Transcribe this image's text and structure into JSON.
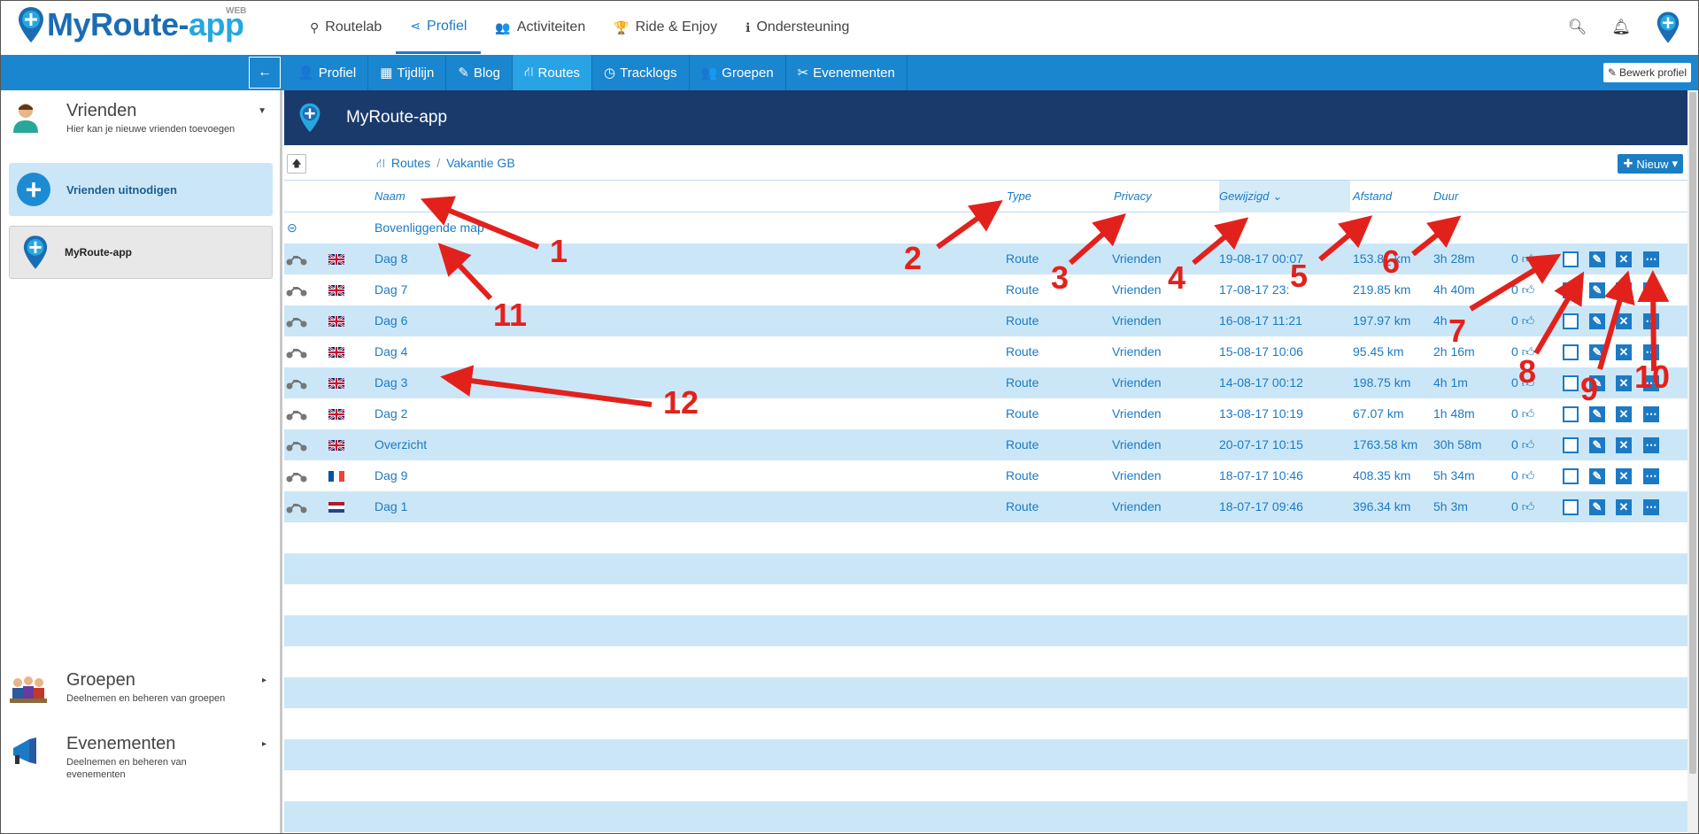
{
  "app": {
    "logo_prefix": "MyRoute-",
    "logo_suffix": "app",
    "logo_badge": "WEB"
  },
  "topnav": [
    {
      "label": "Routelab",
      "icon": "map-marker-icon",
      "glyph": "⚲"
    },
    {
      "label": "Profiel",
      "icon": "share-icon",
      "glyph": "⋖",
      "active": true
    },
    {
      "label": "Activiteiten",
      "icon": "users-icon",
      "glyph": "👥"
    },
    {
      "label": "Ride & Enjoy",
      "icon": "trophy-icon",
      "glyph": "🏆"
    },
    {
      "label": "Ondersteuning",
      "icon": "info-icon",
      "glyph": "ℹ"
    }
  ],
  "subnav": {
    "back_glyph": "←",
    "tabs": [
      {
        "label": "Profiel",
        "icon": "user-icon",
        "glyph": "👤"
      },
      {
        "label": "Tijdlijn",
        "icon": "calendar-icon",
        "glyph": "▦"
      },
      {
        "label": "Blog",
        "icon": "pencil-icon",
        "glyph": "✎"
      },
      {
        "label": "Routes",
        "icon": "road-icon",
        "glyph": "⛙",
        "active": true
      },
      {
        "label": "Tracklogs",
        "icon": "clock-icon",
        "glyph": "◷"
      },
      {
        "label": "Groepen",
        "icon": "users-icon",
        "glyph": "👥"
      },
      {
        "label": "Evenementen",
        "icon": "ticket-icon",
        "glyph": "✂"
      }
    ],
    "edit_profile_label": "Bewerk profiel"
  },
  "sidebar": {
    "friends_title": "Vrienden",
    "friends_sub": "Hier kan je nieuwe vrienden toevoegen",
    "invite_label": "Vrienden uitnodigen",
    "friend_name": "MyRoute-app",
    "groups_title": "Groepen",
    "groups_sub": "Deelnemen en beheren van groepen",
    "events_title": "Evenementen",
    "events_sub": "Deelnemen en beheren van evenementen"
  },
  "main": {
    "header_title": "MyRoute-app",
    "breadcrumb": {
      "root": "Routes",
      "folder": "Vakantie GB"
    },
    "new_button": "Nieuw",
    "columns": {
      "name": "Naam",
      "type": "Type",
      "privacy": "Privacy",
      "modified": "Gewijzigd",
      "distance": "Afstand",
      "duration": "Duur"
    },
    "parent_folder": "Bovenliggende map",
    "rows": [
      {
        "flag": "gb",
        "name": "Dag 8",
        "type": "Route",
        "privacy": "Vrienden",
        "modified": "19-08-17 00:07",
        "distance": "153.8_ km",
        "duration": "3h 28m",
        "likes": "0"
      },
      {
        "flag": "gb",
        "name": "Dag 7",
        "type": "Route",
        "privacy": "Vrienden",
        "modified": "17-08-17 23:",
        "distance": "219.85 km",
        "duration": "4h 40m",
        "likes": "0"
      },
      {
        "flag": "gb",
        "name": "Dag 6",
        "type": "Route",
        "privacy": "Vrienden",
        "modified": "16-08-17 11:21",
        "distance": "197.97 km",
        "duration": "4h",
        "likes": "0"
      },
      {
        "flag": "gb",
        "name": "Dag 4",
        "type": "Route",
        "privacy": "Vrienden",
        "modified": "15-08-17 10:06",
        "distance": "95.45 km",
        "duration": "2h 16m",
        "likes": "0"
      },
      {
        "flag": "gb",
        "name": "Dag 3",
        "type": "Route",
        "privacy": "Vrienden",
        "modified": "14-08-17 00:12",
        "distance": "198.75 km",
        "duration": "4h 1m",
        "likes": "0"
      },
      {
        "flag": "gb",
        "name": "Dag 2",
        "type": "Route",
        "privacy": "Vrienden",
        "modified": "13-08-17 10:19",
        "distance": "67.07 km",
        "duration": "1h 48m",
        "likes": "0"
      },
      {
        "flag": "gb",
        "name": "Overzicht",
        "type": "Route",
        "privacy": "Vrienden",
        "modified": "20-07-17 10:15",
        "distance": "1763.58 km",
        "duration": "30h 58m",
        "likes": "0"
      },
      {
        "flag": "fr",
        "name": "Dag 9",
        "type": "Route",
        "privacy": "Vrienden",
        "modified": "18-07-17 10:46",
        "distance": "408.35 km",
        "duration": "5h 34m",
        "likes": "0"
      },
      {
        "flag": "nl",
        "name": "Dag 1",
        "type": "Route",
        "privacy": "Vrienden",
        "modified": "18-07-17 09:46",
        "distance": "396.34 km",
        "duration": "5h 3m",
        "likes": "0"
      }
    ],
    "empty_rows": 10
  },
  "annotations": [
    "1",
    "2",
    "3",
    "4",
    "5",
    "6",
    "7",
    "8",
    "9",
    "10",
    "11",
    "12"
  ],
  "colors": {
    "brand": "#1c6cb4",
    "accent": "#1a86d0",
    "header": "#1a3a6b",
    "row_alt": "#cbe7f7",
    "annotation": "#e3211c"
  }
}
